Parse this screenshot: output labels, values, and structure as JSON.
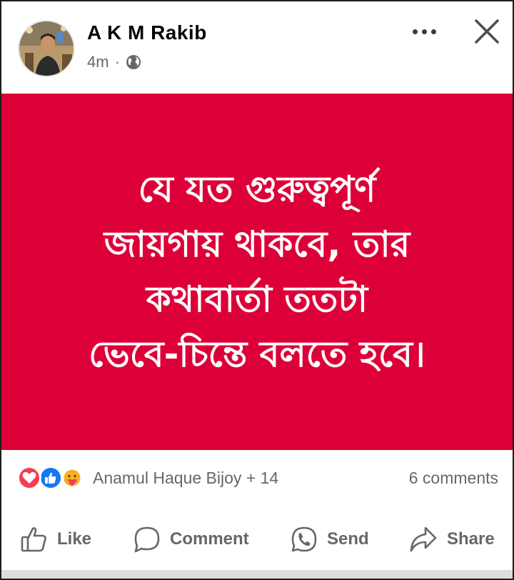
{
  "post": {
    "author_name": "A K M Rakib",
    "time_ago": "4m",
    "meta_separator": "·",
    "privacy_icon": "globe-icon",
    "image_background_color": "#dd0038",
    "image_text_lines": [
      "যে যত গুরুত্বপূর্ণ",
      "জায়গায় থাকবে, তার",
      "কথাবার্তা ততটা",
      "ভেবে-চিন্তে বলতে হবে।"
    ]
  },
  "reactions": {
    "icons": [
      "love-icon",
      "like-icon",
      "care-icon"
    ],
    "summary_text": "Anamul Haque Bijoy + 14",
    "comments_text": "6 comments"
  },
  "actions": {
    "like_label": "Like",
    "comment_label": "Comment",
    "send_label": "Send",
    "share_label": "Share"
  },
  "colors": {
    "accent_like": "#1877f2",
    "accent_love": "#f33e58",
    "secondary_text": "#65676b"
  }
}
